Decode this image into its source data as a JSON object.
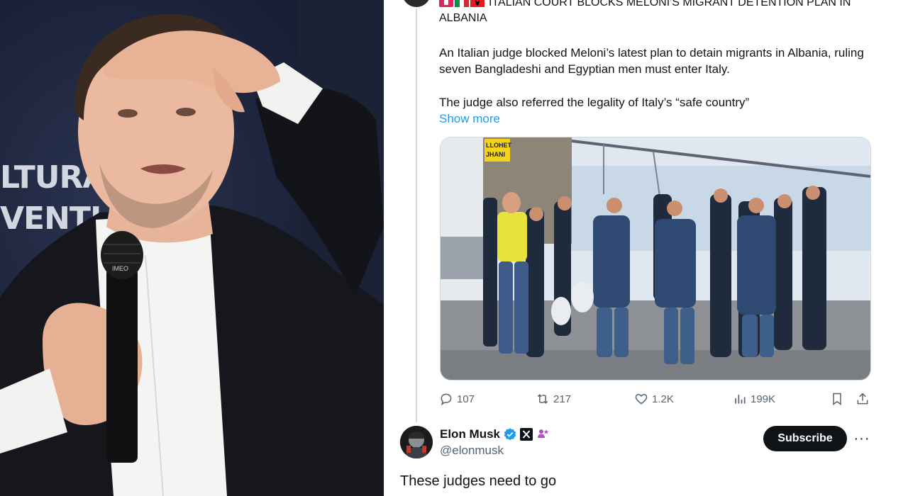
{
  "photo": {
    "backdrop_line_1": "LTURA",
    "backdrop_line_2": "VENTI",
    "microphone_brand": "IMEO"
  },
  "quoted_post": {
    "headline": "ITALIAN COURT BLOCKS MELONI'S MIGRANT DETENTION PLAN IN ALBANIA",
    "paragraph_1": "An Italian judge blocked Meloni’s latest plan to detain migrants in Albania, ruling seven Bangladeshi and Egyptian men must enter Italy.",
    "paragraph_2": "The judge also referred the legality of Italy’s “safe country”",
    "show_more": "Show more",
    "media_sign_text_1": "LLOHET",
    "media_sign_text_2": "JHANI"
  },
  "actions": {
    "replies": "107",
    "reposts": "217",
    "likes": "1.2K",
    "views": "199K"
  },
  "reply": {
    "name": "Elon Musk",
    "handle": "@elonmusk",
    "subscribe_label": "Subscribe",
    "more_label": "···",
    "text": "These judges need to go"
  },
  "colors": {
    "link": "#1d9bf0",
    "text_primary": "#0f1419",
    "text_secondary": "#536471",
    "verified_badge": "#1d9bf0",
    "affiliate_badge": "#b54fc1",
    "subscribe_bg": "#0f1419"
  },
  "icons": {
    "reply": "reply-bubble-icon",
    "repost": "repost-icon",
    "like": "heart-icon",
    "views": "views-bar-chart-icon",
    "bookmark": "bookmark-icon",
    "share": "share-upload-icon",
    "verified": "verified-badge-icon",
    "x_logo": "x-logo-icon",
    "affiliate": "affiliate-badge-icon"
  }
}
